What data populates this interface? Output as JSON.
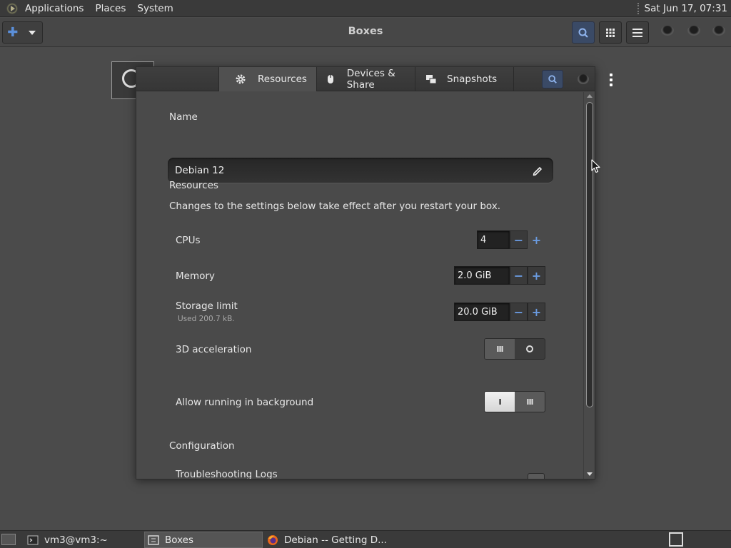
{
  "top_panel": {
    "menus": [
      "Applications",
      "Places",
      "System"
    ],
    "clock": "Sat Jun 17, 07:31"
  },
  "header": {
    "title": "Boxes",
    "new_icon": "plus-icon",
    "new_menu_icon": "chevron-down-icon",
    "search_icon": "search-icon",
    "grid_icon": "grid-view-icon",
    "menu_icon": "hamburger-menu-icon"
  },
  "dialog": {
    "tabs": [
      {
        "label": "Resources",
        "icon": "gear-icon",
        "active": true
      },
      {
        "label": "Devices & Share",
        "icon": "mouse-icon",
        "active": false
      },
      {
        "label": "Snapshots",
        "icon": "snapshots-icon",
        "active": false
      }
    ],
    "name_label": "Name",
    "name_value": "Debian 12",
    "resources_label": "Resources",
    "resources_desc": "Changes to the settings below take effect after you restart your box.",
    "cpus": {
      "label": "CPUs",
      "value": "4"
    },
    "memory": {
      "label": "Memory",
      "value": "2.0 GiB"
    },
    "storage": {
      "label": "Storage limit",
      "sub": "Used 200.7 kB.",
      "value": "20.0 GiB"
    },
    "accel": {
      "label": "3D acceleration",
      "state": "off",
      "on_mark": "III"
    },
    "background": {
      "label": "Allow running in background",
      "state": "on",
      "on_mark": "I",
      "off_mark": "III"
    },
    "configuration_label": "Configuration",
    "troubleshooting_label": "Troubleshooting Logs"
  },
  "taskbar": {
    "tasks": [
      {
        "label": "vm3@vm3:~",
        "icon": "terminal-icon"
      },
      {
        "label": "Boxes",
        "icon": "boxes-icon",
        "active": true
      },
      {
        "label": "Debian -- Getting D...",
        "icon": "firefox-icon"
      }
    ]
  },
  "colors": {
    "accent": "#5b8fd9",
    "background": "#4b4b4b",
    "panel": "#3a3a3a"
  }
}
